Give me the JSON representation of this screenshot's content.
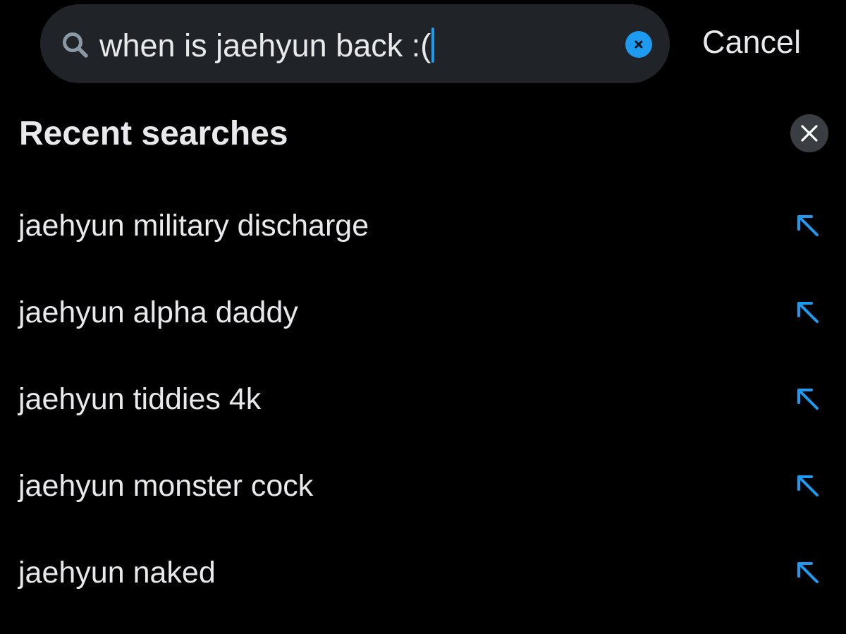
{
  "search": {
    "query": "when is jaehyun back :(",
    "cancel_label": "Cancel",
    "search_icon": "search-icon",
    "clear_icon": "clear-icon"
  },
  "recent": {
    "title": "Recent searches",
    "clear_all_icon": "close-icon",
    "items": [
      {
        "label": "jaehyun military discharge",
        "icon": "fill-arrow-icon"
      },
      {
        "label": "jaehyun alpha daddy",
        "icon": "fill-arrow-icon"
      },
      {
        "label": "jaehyun tiddies 4k",
        "icon": "fill-arrow-icon"
      },
      {
        "label": "jaehyun monster cock",
        "icon": "fill-arrow-icon"
      },
      {
        "label": "jaehyun naked",
        "icon": "fill-arrow-icon"
      }
    ]
  },
  "colors": {
    "background": "#000000",
    "search_field": "#202327",
    "accent": "#1d9bf0",
    "text": "#e7e9ea",
    "icon_muted": "#8b98a5",
    "clear_all_bg": "#3a3d41"
  }
}
